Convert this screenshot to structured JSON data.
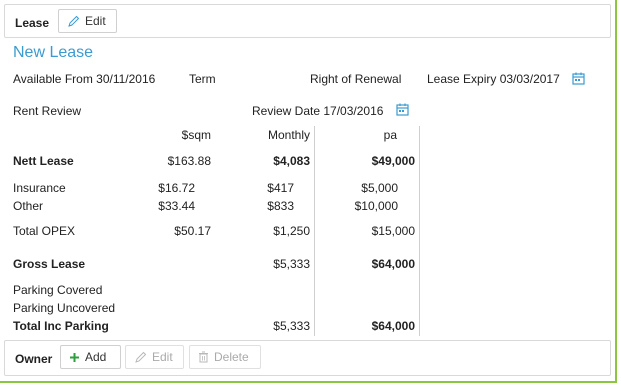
{
  "lease_panel": {
    "title": "Lease",
    "edit_label": "Edit"
  },
  "heading": "New Lease",
  "fields": {
    "available_from": "Available From 30/11/2016",
    "term": "Term",
    "right_of_renewal": "Right of Renewal",
    "lease_expiry": "Lease Expiry 03/03/2017",
    "rent_review": "Rent Review",
    "review_date": "Review Date 17/03/2016"
  },
  "table": {
    "headers": [
      "$sqm",
      "Monthly",
      "pa"
    ],
    "rows": [
      {
        "label": "Nett Lease",
        "sqm": "$163.88",
        "monthly": "$4,083",
        "pa": "$49,000",
        "bold": true
      },
      {
        "label": "Insurance",
        "sqm": "$16.72",
        "monthly": "$417",
        "pa": "$5,000"
      },
      {
        "label": "Other",
        "sqm": "$33.44",
        "monthly": "$833",
        "pa": "$10,000"
      },
      {
        "label": "Total OPEX",
        "sqm": "$50.17",
        "monthly": "$1,250",
        "pa": "$15,000"
      },
      {
        "label": "Gross Lease",
        "sqm": "",
        "monthly": "$5,333",
        "pa": "$64,000",
        "bold": true
      },
      {
        "label": "Parking Covered",
        "sqm": "",
        "monthly": "",
        "pa": ""
      },
      {
        "label": "Parking Uncovered",
        "sqm": "",
        "monthly": "",
        "pa": ""
      },
      {
        "label": "Total Inc Parking",
        "sqm": "",
        "monthly": "$5,333",
        "pa": "$64,000",
        "bold": true
      }
    ]
  },
  "owner_panel": {
    "title": "Owner",
    "add_label": "Add",
    "edit_label": "Edit",
    "delete_label": "Delete"
  },
  "colors": {
    "accent": "#3b9bd0",
    "frame": "#8cc63e",
    "add_green": "#2e9e3e"
  }
}
